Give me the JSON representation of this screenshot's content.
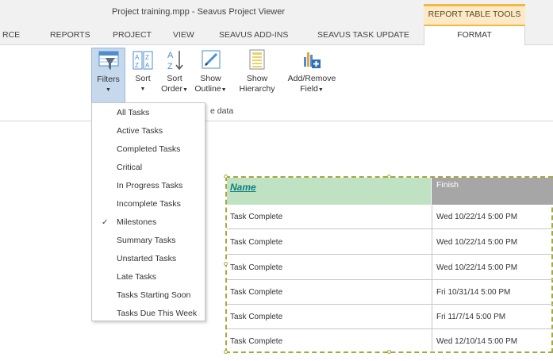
{
  "window": {
    "title": "Project training.mpp - Seavus Project Viewer",
    "context_group": "REPORT TABLE TOOLS"
  },
  "tabs": [
    {
      "label": "RCE"
    },
    {
      "label": "REPORTS"
    },
    {
      "label": "PROJECT"
    },
    {
      "label": "VIEW"
    },
    {
      "label": "SEAVUS ADD-INS"
    },
    {
      "label": "SEAVUS TASK UPDATE"
    },
    {
      "label": "FORMAT",
      "active": true
    }
  ],
  "ribbon": {
    "filters": {
      "label": "Filters",
      "icon": "filter-icon"
    },
    "sort": {
      "label": "Sort",
      "icon": "sort-az-icon"
    },
    "sort_order": {
      "label1": "Sort",
      "label2": "Order",
      "icon": "sort-order-icon"
    },
    "show_outline": {
      "label1": "Show",
      "label2": "Outline",
      "icon": "outline-pencil-icon"
    },
    "show_hierarchy": {
      "label1": "Show",
      "label2": "Hierarchy",
      "icon": "hierarchy-icon"
    },
    "add_remove_field": {
      "label1": "Add/Remove",
      "label2": "Field",
      "icon": "add-field-icon"
    },
    "group_label": "e data"
  },
  "filter_menu": {
    "items": [
      {
        "label": "All Tasks",
        "checked": false
      },
      {
        "label": "Active Tasks",
        "checked": false
      },
      {
        "label": "Completed Tasks",
        "checked": false
      },
      {
        "label": "Critical",
        "checked": false
      },
      {
        "label": "In Progress Tasks",
        "checked": false
      },
      {
        "label": "Incomplete Tasks",
        "checked": false
      },
      {
        "label": "Milestones",
        "checked": true
      },
      {
        "label": "Summary Tasks",
        "checked": false
      },
      {
        "label": "Unstarted Tasks",
        "checked": false
      },
      {
        "label": "Late Tasks",
        "checked": false
      },
      {
        "label": "Tasks Starting Soon",
        "checked": false
      },
      {
        "label": "Tasks Due This Week",
        "checked": false
      }
    ],
    "check_mark": "✓"
  },
  "report_table": {
    "columns": [
      "Name",
      "Finish"
    ],
    "rows": [
      {
        "name": "Task Complete",
        "finish": "Wed 10/22/14 5:00 PM"
      },
      {
        "name": "Task Complete",
        "finish": "Wed 10/22/14 5:00 PM"
      },
      {
        "name": "Task Complete",
        "finish": "Wed 10/22/14 5:00 PM"
      },
      {
        "name": "Task Complete",
        "finish": "Fri 10/31/14 5:00 PM"
      },
      {
        "name": "Task Complete",
        "finish": "Fri 11/7/14 5:00 PM"
      },
      {
        "name": "Task Complete",
        "finish": "Wed 12/10/14 5:00 PM"
      }
    ]
  },
  "colors": {
    "context_tab": "#f2b845",
    "header_name_bg": "#bfe2c3",
    "header_name_text": "#0e7f7f",
    "header_finish_bg": "#a6a6a6",
    "frame": "#a7a83c"
  }
}
